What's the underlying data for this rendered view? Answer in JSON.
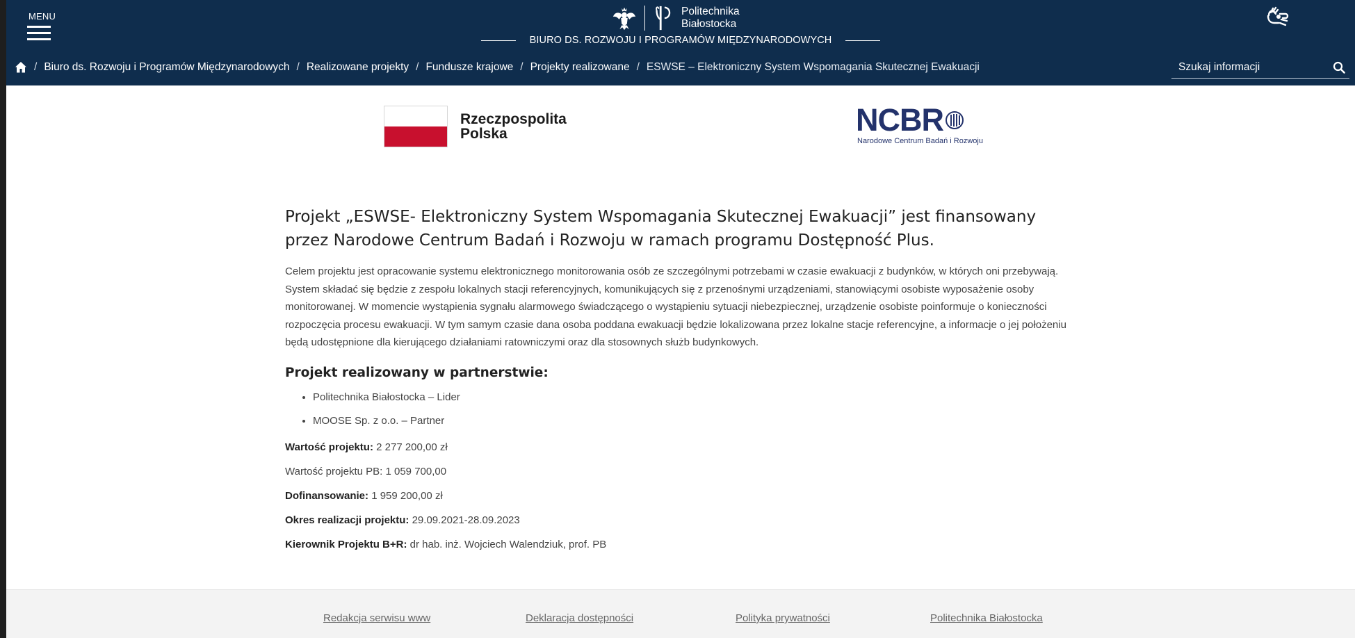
{
  "header": {
    "menu_label": "MENU",
    "brand_name_line1": "Politechnika",
    "brand_name_line2": "Białostocka",
    "subtitle": "BIURO DS. ROZWOJU I PROGRAMÓW MIĘDZYNARODOWYCH",
    "accessibility_icon": "sign-language-icon"
  },
  "breadcrumb": {
    "home_icon": "home-icon",
    "items": [
      "Biuro ds. Rozwoju i Programów Międzynarodowych",
      "Realizowane projekty",
      "Fundusze krajowe",
      "Projekty realizowane"
    ],
    "current": "ESWSE – Elektroniczny System Wspomagania Skutecznej Ewakuacji",
    "separator": "/"
  },
  "search": {
    "placeholder": "Szukaj informacji",
    "icon": "search-icon"
  },
  "logos": {
    "rp_line1": "Rzeczpospolita",
    "rp_line2": "Polska",
    "ncbr_word": "NCBR",
    "ncbr_sub": "Narodowe Centrum Badań i Rozwoju"
  },
  "content": {
    "title": "Projekt „ESWSE- Elektroniczny System Wspomagania Skutecznej Ewakuacji” jest finansowany przez Narodowe Centrum Badań i Rozwoju w ramach programu Dostępność Plus.",
    "description": "Celem projektu jest opracowanie systemu elektronicznego monitorowania osób ze szczególnymi potrzebami w czasie ewakuacji z budynków, w których oni przebywają. System składać się będzie z zespołu lokalnych stacji referencyjnych, komunikujących się z przenośnymi urządzeniami, stanowiącymi osobiste wyposażenie osoby monitorowanej. W momencie wystąpienia sygnału alarmowego świadczącego o wystąpieniu sytuacji niebezpiecznej, urządzenie osobiste poinformuje o konieczności rozpoczęcia procesu ewakuacji. W tym samym czasie dana osoba poddana ewakuacji będzie lokalizowana przez lokalne stacje referencyjne, a informacje o jej położeniu będą udostępnione dla kierującego działaniami ratowniczymi oraz dla stosownych służb budynkowych.",
    "partnership_heading": "Projekt realizowany w partnerstwie:",
    "partners": [
      "Politechnika Białostocka – Lider",
      "MOOSE Sp. z o.o. – Partner"
    ],
    "facts": {
      "value_label": "Wartość projektu:",
      "value": "2 277 200,00 zł",
      "value_pb": "Wartość projektu PB: 1 059 700,00",
      "funding_label": "Dofinansowanie:",
      "funding": "1 959 200,00 zł",
      "period_label": "Okres realizacji projektu:",
      "period": "29.09.2021-28.09.2023",
      "manager_label": "Kierownik Projektu B+R:",
      "manager": "dr hab. inż. Wojciech Walendziuk, prof. PB"
    }
  },
  "footer": {
    "links": [
      "Redakcja serwisu www",
      "Deklaracja dostępności",
      "Polityka prywatności",
      "Politechnika Białostocka"
    ]
  },
  "colors": {
    "header_bg": "#0f2d4d",
    "flag_red": "#c8102e",
    "ncbr_blue": "#23326b",
    "footer_bg": "#f3f3f3"
  }
}
